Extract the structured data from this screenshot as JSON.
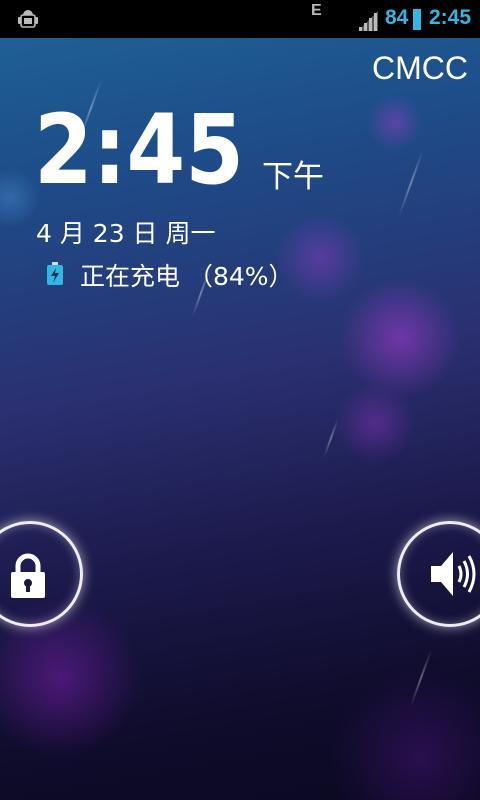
{
  "status_bar": {
    "network_type": "E",
    "battery_percent": "84",
    "time": "2:45",
    "accent_color": "#33b5e5",
    "icons": [
      "android-debug-icon",
      "signal-strength-icon",
      "battery-icon"
    ]
  },
  "carrier": "CMCC",
  "clock": {
    "time": "2:45",
    "ampm": "下午"
  },
  "date": "4 月 23 日 周一",
  "charging": {
    "icon": "battery-charging-icon",
    "text": "正在充电 （84%）"
  },
  "actions": {
    "unlock_icon": "lock-icon",
    "sound_icon": "speaker-icon"
  }
}
